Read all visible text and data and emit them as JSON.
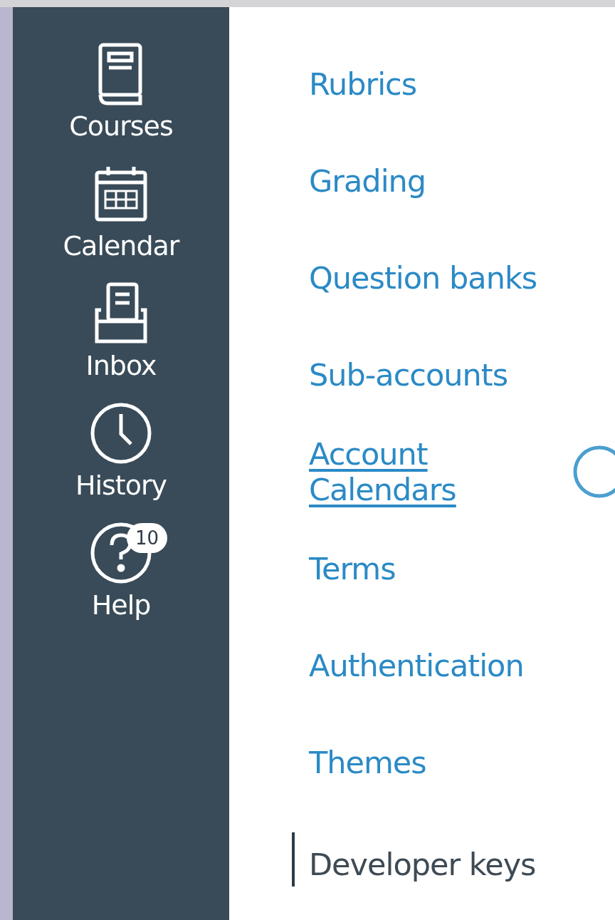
{
  "sidebar": {
    "items": [
      {
        "kind": "courses",
        "label": "Courses"
      },
      {
        "kind": "calendar",
        "label": "Calendar"
      },
      {
        "kind": "inbox",
        "label": "Inbox"
      },
      {
        "kind": "history",
        "label": "History"
      },
      {
        "kind": "help",
        "label": "Help",
        "badge": "10"
      }
    ]
  },
  "menu": {
    "items": [
      {
        "label": "Rubrics",
        "selected": false,
        "hovered": false
      },
      {
        "label": "Grading",
        "selected": false,
        "hovered": false
      },
      {
        "label": "Question banks",
        "selected": false,
        "hovered": false
      },
      {
        "label": "Sub-accounts",
        "selected": false,
        "hovered": false
      },
      {
        "label": "Account Calendars",
        "selected": false,
        "hovered": true,
        "info": true
      },
      {
        "label": "Terms",
        "selected": false,
        "hovered": false
      },
      {
        "label": "Authentication",
        "selected": false,
        "hovered": false
      },
      {
        "label": "Themes",
        "selected": false,
        "hovered": false
      },
      {
        "label": "Developer keys",
        "selected": true,
        "hovered": false
      }
    ]
  }
}
